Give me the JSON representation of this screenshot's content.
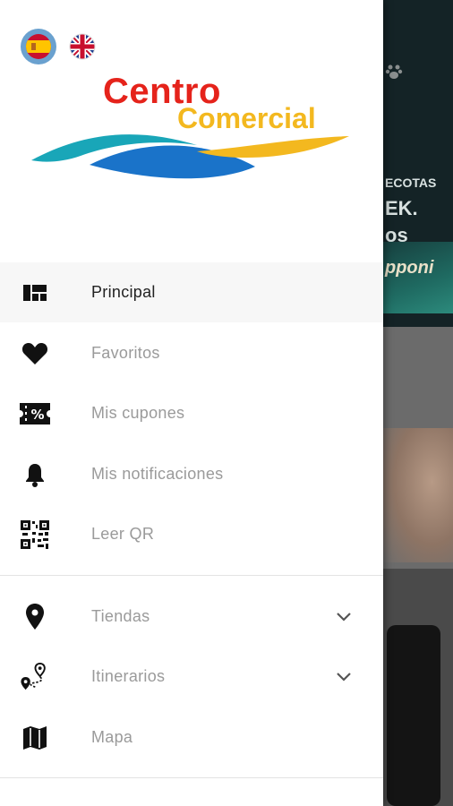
{
  "languages": {
    "spanish_flag": "es-flag-icon",
    "english_flag": "uk-flag-icon"
  },
  "logo": {
    "line1": "Centro",
    "line2": "Comercial",
    "colors": {
      "line1": "#e5231b",
      "line2": "#f3b81f",
      "wave_teal": "#19a6b8",
      "wave_blue": "#1a73c9",
      "wave_gold": "#f3b81f"
    }
  },
  "menu": {
    "primary": [
      {
        "label": "Principal",
        "icon": "dashboard-icon",
        "active": true
      },
      {
        "label": "Favoritos",
        "icon": "heart-icon"
      },
      {
        "label": "Mis cupones",
        "icon": "coupon-icon"
      },
      {
        "label": "Mis notificaciones",
        "icon": "bell-icon"
      },
      {
        "label": "Leer QR",
        "icon": "qr-code-icon"
      }
    ],
    "secondary": [
      {
        "label": "Tiendas",
        "icon": "location-pin-icon",
        "expandable": true
      },
      {
        "label": "Itinerarios",
        "icon": "route-icon",
        "expandable": true
      },
      {
        "label": "Mapa",
        "icon": "map-icon"
      }
    ]
  },
  "background_content": {
    "text1": "ECOTAS",
    "text2": "EK.",
    "text3": "os",
    "text4": "pponi"
  },
  "colors": {
    "active_text": "#222222",
    "inactive_text": "#9a9a9a",
    "active_row_bg": "#f7f7f7"
  }
}
